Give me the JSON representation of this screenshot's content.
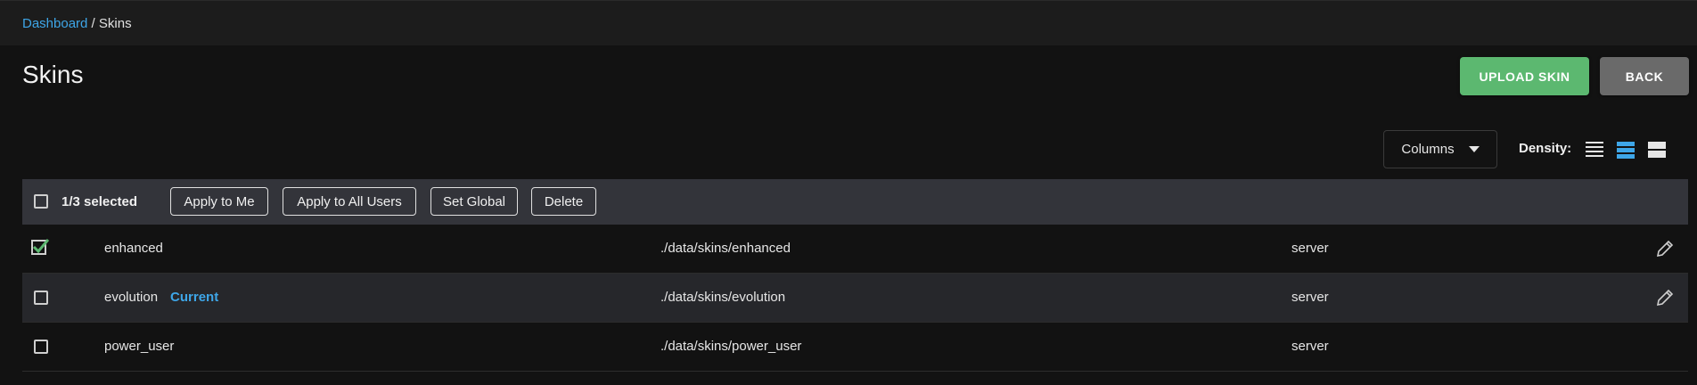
{
  "breadcrumb": {
    "home": "Dashboard",
    "separator": " / ",
    "current": "Skins"
  },
  "page": {
    "title": "Skins"
  },
  "actions": {
    "upload": "UPLOAD SKIN",
    "back": "BACK"
  },
  "grid_controls": {
    "columns_label": "Columns",
    "density_label": "Density:",
    "density_selected": "standard"
  },
  "selection": {
    "text": "1/3 selected",
    "buttons": [
      "Apply to Me",
      "Apply to All Users",
      "Set Global",
      "Delete"
    ]
  },
  "rows": [
    {
      "name": "enhanced",
      "badge": "",
      "path": "./data/skins/enhanced",
      "source": "server",
      "checked": true,
      "editable": true
    },
    {
      "name": "evolution",
      "badge": "Current",
      "path": "./data/skins/evolution",
      "source": "server",
      "checked": false,
      "editable": true
    },
    {
      "name": "power_user",
      "badge": "",
      "path": "./data/skins/power_user",
      "source": "server",
      "checked": false,
      "editable": false
    }
  ],
  "colors": {
    "accent_link": "#3ea6e8",
    "upload_btn": "#5cb870",
    "back_btn": "#6a6a6a",
    "checkbox_checked": "#5cb870"
  },
  "icons": {
    "caret": "chevron-down-icon",
    "edit": "pencil-icon",
    "density": [
      "density-compact-icon",
      "density-standard-icon",
      "density-comfortable-icon"
    ]
  }
}
